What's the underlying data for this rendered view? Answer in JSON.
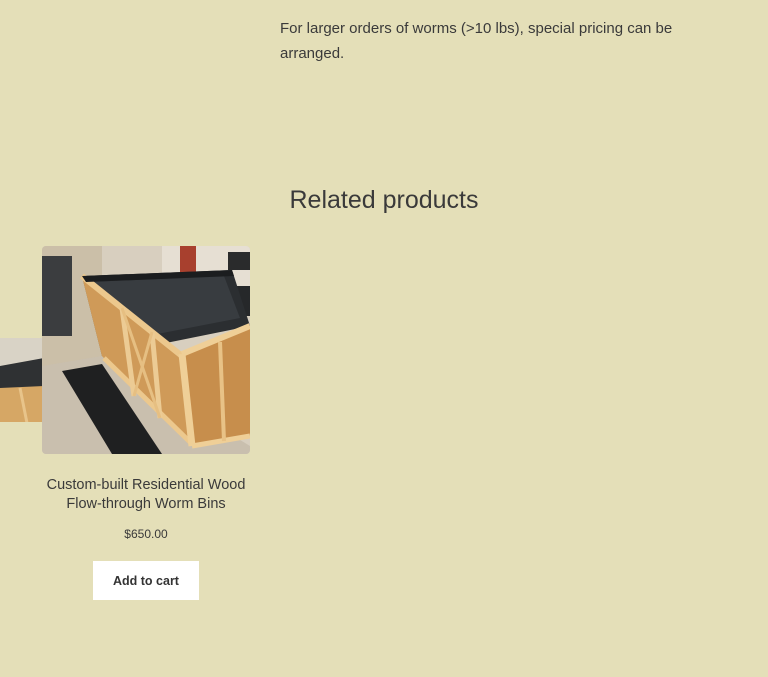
{
  "description": {
    "text": "For larger orders of worms (>10 lbs), special pricing  can be arranged."
  },
  "related": {
    "title": "Related products",
    "products": [
      {
        "name": "Custom-built Residential Wood Flow-through Worm Bins",
        "price": "$650.00",
        "button_label": "Add to cart",
        "image_alt": "wooden worm bin"
      }
    ]
  },
  "colors": {
    "background": "#e4dfb8",
    "button_bg": "#ffffff",
    "text": "#3a3a3a"
  }
}
